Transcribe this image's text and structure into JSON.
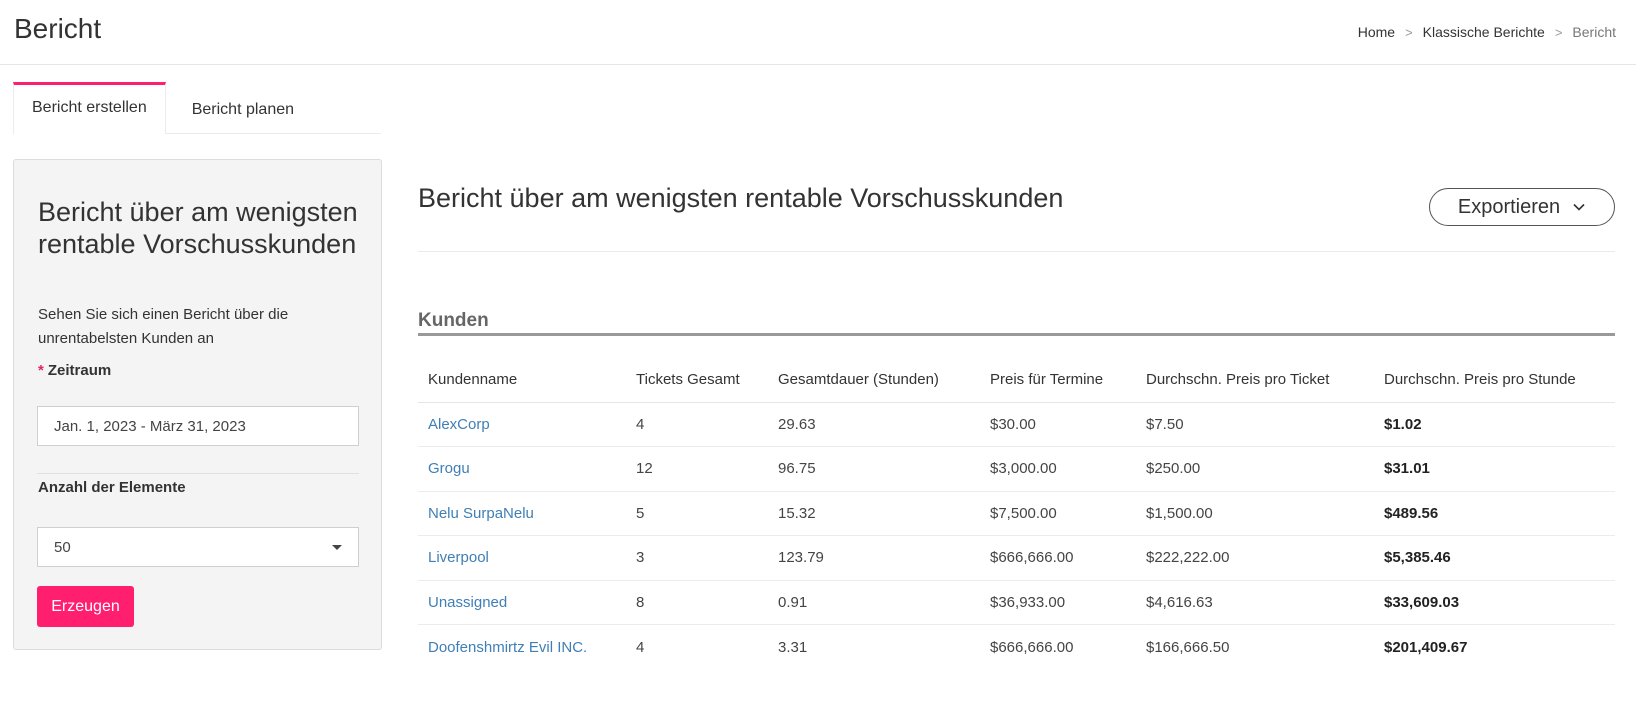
{
  "header": {
    "title": "Bericht",
    "breadcrumb": [
      {
        "label": "Home"
      },
      {
        "label": "Klassische Berichte"
      },
      {
        "label": "Bericht"
      }
    ],
    "separator": ">"
  },
  "tabs": [
    {
      "label": "Bericht erstellen",
      "active": true
    },
    {
      "label": "Bericht planen",
      "active": false
    }
  ],
  "form": {
    "title": "Bericht über am wenigsten rentable Vorschusskunden",
    "description": "Sehen Sie sich einen Bericht über die unrentabelsten Kunden an",
    "required_marker": "*",
    "date_label": "Zeitraum",
    "date_value": "Jan. 1, 2023 - März 31, 2023",
    "count_label": "Anzahl der Elemente",
    "count_value": "50",
    "submit_label": "Erzeugen"
  },
  "report": {
    "title": "Bericht über am wenigsten rentable Vorschusskunden",
    "export_label": "Exportieren",
    "section_title": "Kunden",
    "columns": [
      "Kundenname",
      "Tickets Gesamt",
      "Gesamtdauer (Stunden)",
      "Preis für Termine",
      "Durchschn. Preis pro Ticket",
      "Durchschn. Preis pro Stunde"
    ],
    "rows": [
      [
        "AlexCorp",
        "4",
        "29.63",
        "$30.00",
        "$7.50",
        "$1.02"
      ],
      [
        "Grogu",
        "12",
        "96.75",
        "$3,000.00",
        "$250.00",
        "$31.01"
      ],
      [
        "Nelu SurpaNelu",
        "5",
        "15.32",
        "$7,500.00",
        "$1,500.00",
        "$489.56"
      ],
      [
        "Liverpool",
        "3",
        "123.79",
        "$666,666.00",
        "$222,222.00",
        "$5,385.46"
      ],
      [
        "Unassigned",
        "8",
        "0.91",
        "$36,933.00",
        "$4,616.63",
        "$33,609.03"
      ],
      [
        "Doofenshmirtz Evil INC.",
        "4",
        "3.31",
        "$666,666.00",
        "$166,666.50",
        "$201,409.67"
      ]
    ]
  },
  "colors": {
    "accent": "#ff1f6e",
    "link": "#3f7fb6"
  },
  "icons": {
    "export_dropdown": "chevron-down-icon",
    "select_dropdown": "caret-down-icon"
  }
}
